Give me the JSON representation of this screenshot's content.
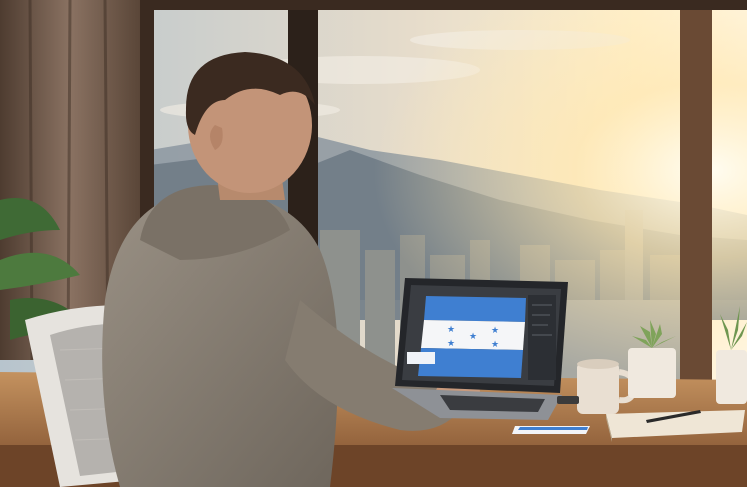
{
  "scene": {
    "description_colors": {
      "sky_top": "#b9c6cf",
      "sky_glow": "#fff4d6",
      "sun": "#fffbe8",
      "mountains": "#6e7a84",
      "city": "#8b8f8c",
      "window_frame": "#3a2a20",
      "curtain": "#6b5647",
      "desk": "#a9744a",
      "hoodie": "#8a8176",
      "hair": "#3b2a20",
      "skin": "#c89a7d",
      "chair": "#e6e3de",
      "laptop": "#2b2d31",
      "flag_blue": "#3f7fd1",
      "flag_white": "#f5f6f8",
      "mug": "#e9dfd2",
      "plant_pot": "#f0e9df",
      "succulent": "#7fa35a",
      "notebook": "#efe6d6",
      "pen": "#2a2a2a"
    },
    "icons": [
      "person-at-desk",
      "laptop-icon",
      "honduras-flag",
      "coffee-mug-icon",
      "potted-plant-icon",
      "notebook-icon",
      "pen-icon",
      "office-chair"
    ]
  }
}
